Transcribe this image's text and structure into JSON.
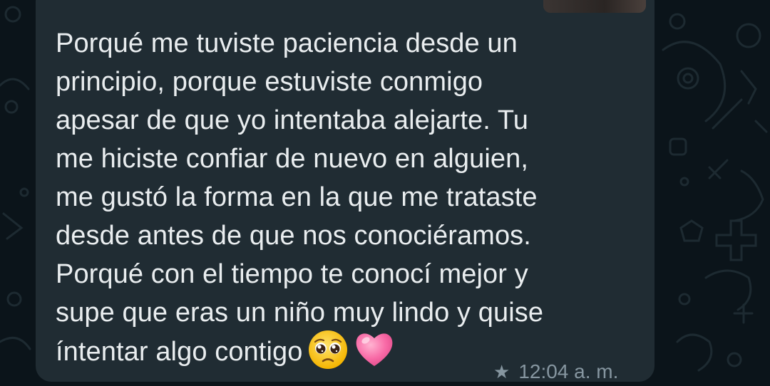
{
  "message": {
    "lines": [
      "Porqué me tuviste paciencia desde un",
      "principio, porque estuviste conmigo",
      "apesar de que yo intentaba alejarte. Tu",
      "me hiciste confiar de nuevo en alguien,",
      "me gustó la forma en la que me trataste",
      "desde antes de que nos conociéramos.",
      "Porqué con el tiempo te conocí mejor y",
      "supe que eras un niño muy lindo y quise",
      "íntentar algo contigo"
    ],
    "emojis": [
      "pleading-face",
      "pink-heart"
    ],
    "starred": true,
    "time": "12:04 a. m."
  },
  "colors": {
    "chat_background": "#0b141a",
    "bubble": "#202c33",
    "text": "#e9edef",
    "meta": "#8696a0",
    "reply_accent": "#06cf9c"
  }
}
